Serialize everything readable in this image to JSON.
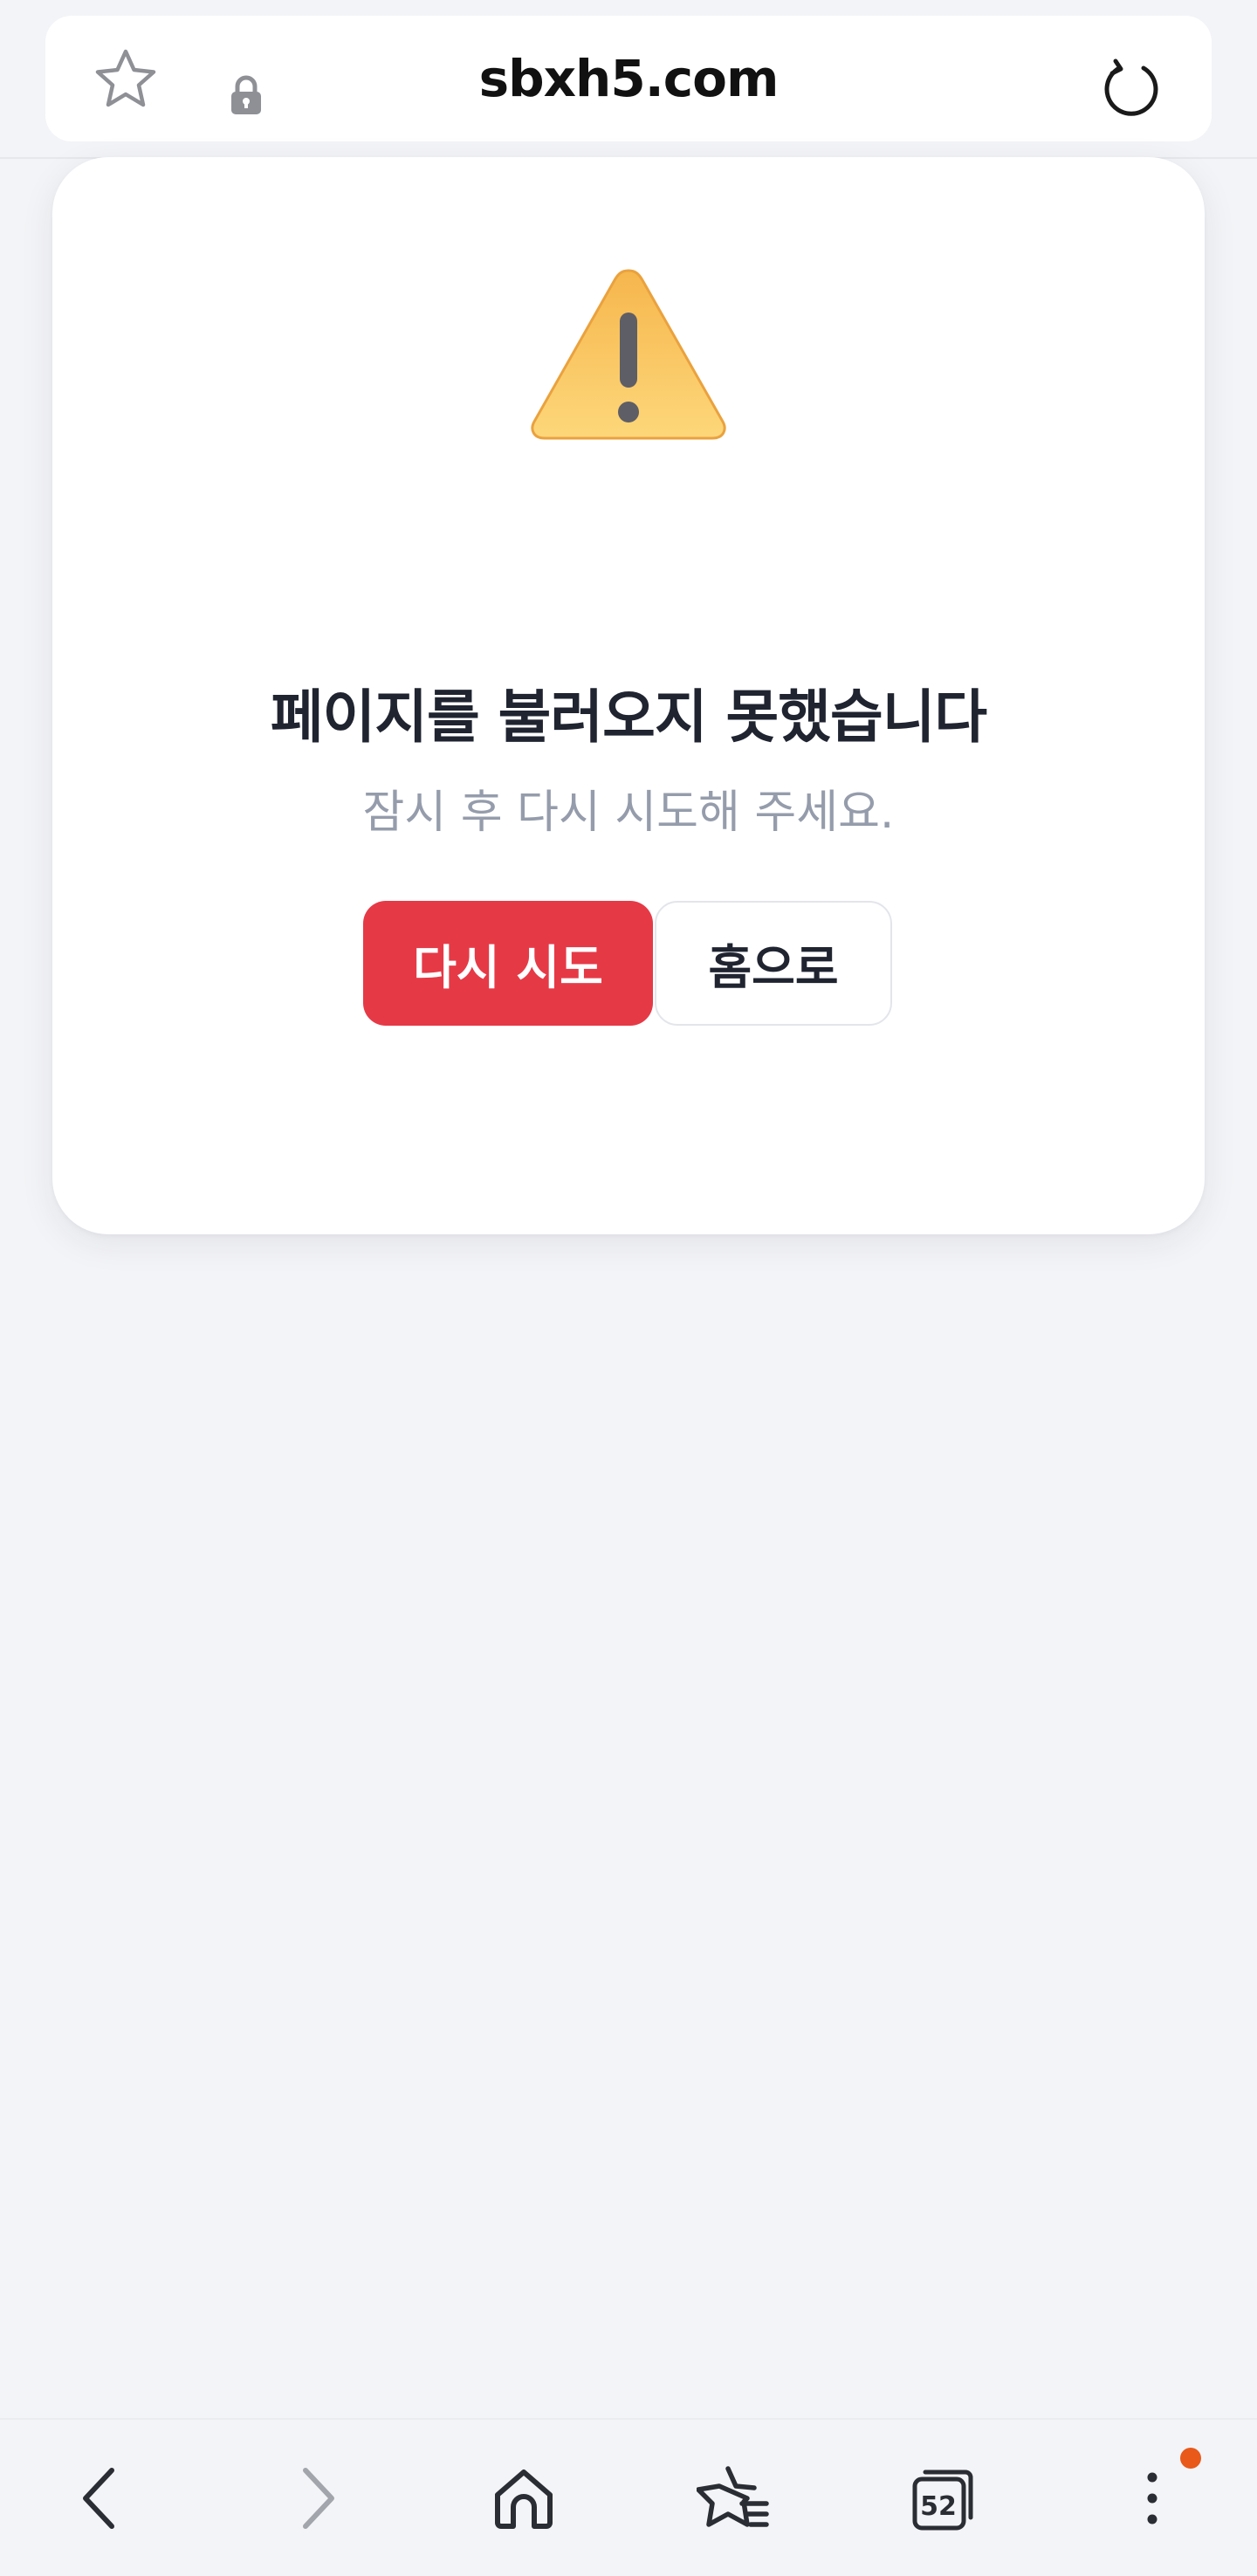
{
  "browser": {
    "url": "sbxh5.com",
    "icons": {
      "bookmark": "star-outline-icon",
      "secure": "lock-icon",
      "reload": "reload-icon"
    }
  },
  "error": {
    "icon": "warning-icon",
    "title": "페이지를 불러오지 못했습니다",
    "subtitle": "잠시 후 다시 시도해 주세요.",
    "retry_label": "다시 시도",
    "home_label": "홈으로",
    "colors": {
      "accent": "#e63946",
      "title": "#1f2430",
      "subtitle": "#959cab"
    }
  },
  "bottom_nav": {
    "items": [
      {
        "name": "back",
        "icon": "chevron-left-icon"
      },
      {
        "name": "forward",
        "icon": "chevron-right-icon"
      },
      {
        "name": "home",
        "icon": "home-icon"
      },
      {
        "name": "bookmarks",
        "icon": "star-list-icon"
      },
      {
        "name": "tabs",
        "icon": "tabs-icon"
      },
      {
        "name": "menu",
        "icon": "more-vertical-icon"
      }
    ],
    "tab_count": "52",
    "notification_color": "#e8591a"
  }
}
